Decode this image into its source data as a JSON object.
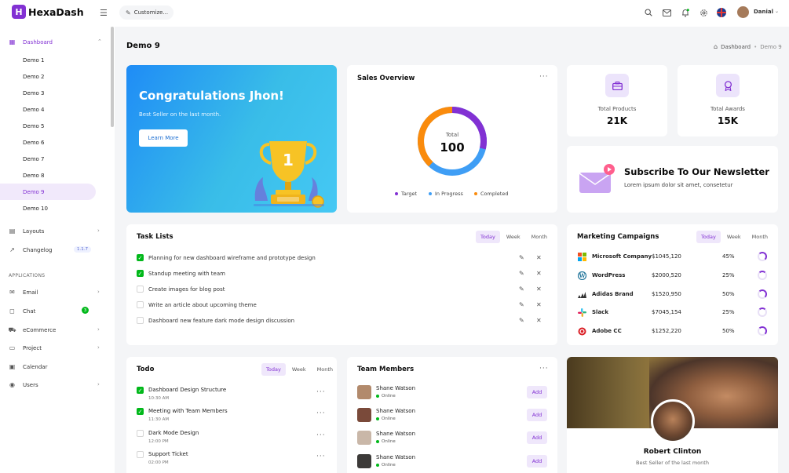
{
  "app": {
    "logo_letter": "H",
    "name": "HexaDash"
  },
  "topbar": {
    "customize_label": "Customize...",
    "icons": [
      "search-icon",
      "mail-icon",
      "bell-icon",
      "settings-icon",
      "flag-uk-icon"
    ],
    "user_name": "Danial"
  },
  "sidebar": {
    "dashboard_label": "Dashboard",
    "demos": [
      "Demo 1",
      "Demo 2",
      "Demo 3",
      "Demo 4",
      "Demo 5",
      "Demo 6",
      "Demo 7",
      "Demo 8",
      "Demo 9",
      "Demo 10"
    ],
    "active_demo": "Demo 9",
    "layouts_label": "Layouts",
    "changelog_label": "Changelog",
    "changelog_version": "1.1.7",
    "section_label": "APPLICATIONS",
    "email_label": "Email",
    "chat_label": "Chat",
    "chat_badge": "3",
    "ecommerce_label": "eCommerce",
    "project_label": "Project",
    "calendar_label": "Calendar",
    "users_label": "Users"
  },
  "page": {
    "title": "Demo 9",
    "breadcrumb_home": "Dashboard",
    "breadcrumb_sep": "•",
    "breadcrumb_current": "Demo 9"
  },
  "hero": {
    "title": "Congratulations Jhon!",
    "subtitle": "Best Seller on the last month.",
    "button": "Learn More"
  },
  "sales": {
    "title": "Sales Overview",
    "total_label": "Total",
    "total_value": "100",
    "legend": [
      {
        "label": "Target",
        "color": "#8231d3"
      },
      {
        "label": "In Progress",
        "color": "#3f9ef5"
      },
      {
        "label": "Completed",
        "color": "#fa8b0c"
      }
    ]
  },
  "stats": [
    {
      "label": "Total Products",
      "value": "21K",
      "icon": "briefcase-icon"
    },
    {
      "label": "Total Awards",
      "value": "15K",
      "icon": "award-icon"
    }
  ],
  "newsletter": {
    "title": "Subscribe To Our Newsletter",
    "subtitle": "Lorem ipsum dolor sit amet, consetetur"
  },
  "tasks": {
    "title": "Task Lists",
    "tabs": [
      "Today",
      "Week",
      "Month"
    ],
    "items": [
      {
        "text": "Planning for new dashboard wireframe and prototype design",
        "done": true
      },
      {
        "text": "Standup meeting with team",
        "done": true
      },
      {
        "text": "Create images for blog post",
        "done": false
      },
      {
        "text": "Write an article about upcoming theme",
        "done": false
      },
      {
        "text": "Dashboard new feature dark mode design discussion",
        "done": false
      }
    ]
  },
  "marketing": {
    "title": "Marketing Campaigns",
    "tabs": [
      "Today",
      "Week",
      "Month"
    ],
    "rows": [
      {
        "name": "Microsoft Company",
        "amount": "$1045,120",
        "percent": "45%",
        "icon": "microsoft-icon",
        "color": "#f25022"
      },
      {
        "name": "WordPress",
        "amount": "$2000,520",
        "percent": "25%",
        "icon": "wordpress-icon",
        "color": "#21759b"
      },
      {
        "name": "Adidas Brand",
        "amount": "$1520,950",
        "percent": "50%",
        "icon": "adidas-icon",
        "color": "#111111"
      },
      {
        "name": "Slack",
        "amount": "$7045,154",
        "percent": "25%",
        "icon": "slack-icon",
        "color": "#e01e5a"
      },
      {
        "name": "Adobe CC",
        "amount": "$1252,220",
        "percent": "50%",
        "icon": "adobe-icon",
        "color": "#da1f26"
      }
    ]
  },
  "todo": {
    "title": "Todo",
    "tabs": [
      "Today",
      "Week",
      "Month"
    ],
    "items": [
      {
        "title": "Dashboard Design Structure",
        "time": "10:30 AM",
        "done": true
      },
      {
        "title": "Meeting with Team Members",
        "time": "11:30 AM",
        "done": true
      },
      {
        "title": "Dark Mode Design",
        "time": "12:00 PM",
        "done": false
      },
      {
        "title": "Support Ticket",
        "time": "02:00 PM",
        "done": false
      }
    ]
  },
  "team": {
    "title": "Team Members",
    "members": [
      {
        "name": "Shane Watson",
        "status": "Online",
        "button": "Add"
      },
      {
        "name": "Shane Watson",
        "status": "Online",
        "button": "Add"
      },
      {
        "name": "Shane Watson",
        "status": "Online",
        "button": "Add"
      },
      {
        "name": "Shane Watson",
        "status": "Online",
        "button": "Add"
      }
    ]
  },
  "profile": {
    "name": "Robert Clinton",
    "role": "Best Seller of the last month"
  }
}
